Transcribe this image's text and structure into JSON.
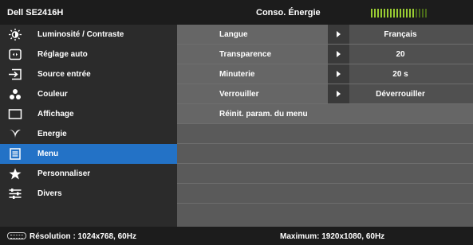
{
  "header": {
    "model": "Dell SE2416H",
    "eco_label": "Conso. Énergie",
    "meter_segments_on": 14,
    "meter_segments_total": 18
  },
  "sidebar": {
    "items": [
      {
        "label": "Luminosité / Contraste",
        "icon": "brightness-icon"
      },
      {
        "label": "Réglage auto",
        "icon": "auto-adjust-icon"
      },
      {
        "label": "Source entrée",
        "icon": "input-source-icon"
      },
      {
        "label": "Couleur",
        "icon": "color-icon"
      },
      {
        "label": "Affichage",
        "icon": "display-icon"
      },
      {
        "label": "Energie",
        "icon": "energy-icon"
      },
      {
        "label": "Menu",
        "icon": "menu-icon",
        "active": true
      },
      {
        "label": "Personnaliser",
        "icon": "star-icon"
      },
      {
        "label": "Divers",
        "icon": "others-icon"
      }
    ]
  },
  "panel": {
    "rows": [
      {
        "label": "Langue",
        "value": "Français",
        "has_arrow": true
      },
      {
        "label": "Transparence",
        "value": "20",
        "has_arrow": true
      },
      {
        "label": "Minuterie",
        "value": "20 s",
        "has_arrow": true
      },
      {
        "label": "Verrouiller",
        "value": "Déverrouiller",
        "has_arrow": true
      },
      {
        "label": "Réinit. param. du menu",
        "value": "",
        "has_arrow": false
      }
    ]
  },
  "footer": {
    "resolution": "Résolution : 1024x768, 60Hz",
    "maximum": "Maximum: 1920x1080, 60Hz"
  },
  "colors": {
    "active": "#2372c6",
    "meter_on": "#9acd32"
  }
}
